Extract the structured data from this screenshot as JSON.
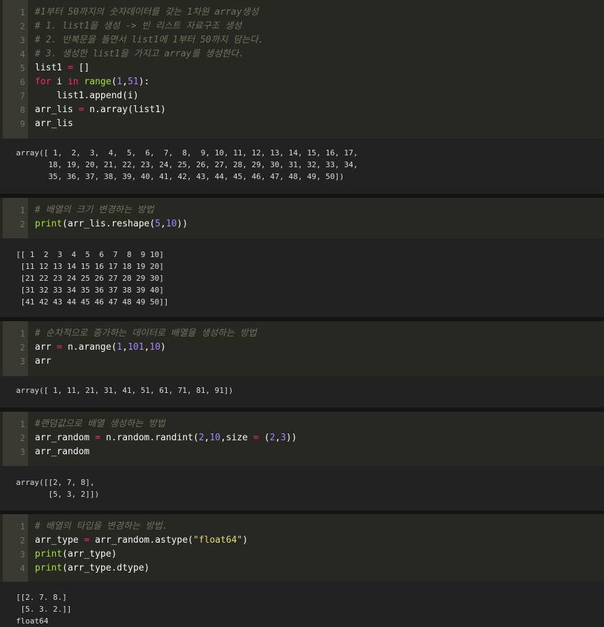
{
  "cells": [
    {
      "lines": [
        {
          "n": "1",
          "tokens": [
            {
              "t": "cm",
              "v": "#1부터 50까지의 숫자데이터를 갖는 1차원 array생성"
            }
          ]
        },
        {
          "n": "2",
          "tokens": [
            {
              "t": "cm",
              "v": "# 1. list1을 생성 -> 빈 리스트 자료구조 생성"
            }
          ]
        },
        {
          "n": "3",
          "tokens": [
            {
              "t": "cm",
              "v": "# 2. 반복문을 돌면서 list1에 1부터 50까지 담는다."
            }
          ]
        },
        {
          "n": "4",
          "tokens": [
            {
              "t": "cm",
              "v": "# 3. 생성한 list1을 가지고 array를 생성한다."
            }
          ]
        },
        {
          "n": "5",
          "tokens": [
            {
              "t": "plain",
              "v": "list1 "
            },
            {
              "t": "op",
              "v": "="
            },
            {
              "t": "plain",
              "v": " []"
            }
          ]
        },
        {
          "n": "6",
          "tokens": [
            {
              "t": "kw",
              "v": "for"
            },
            {
              "t": "plain",
              "v": " i "
            },
            {
              "t": "kw",
              "v": "in"
            },
            {
              "t": "plain",
              "v": " "
            },
            {
              "t": "fn",
              "v": "range"
            },
            {
              "t": "plain",
              "v": "("
            },
            {
              "t": "num",
              "v": "1"
            },
            {
              "t": "plain",
              "v": ","
            },
            {
              "t": "num",
              "v": "51"
            },
            {
              "t": "plain",
              "v": "):"
            }
          ]
        },
        {
          "n": "7",
          "tokens": [
            {
              "t": "plain",
              "v": "    list1.append(i)"
            }
          ]
        },
        {
          "n": "8",
          "tokens": [
            {
              "t": "plain",
              "v": "arr_lis "
            },
            {
              "t": "op",
              "v": "="
            },
            {
              "t": "plain",
              "v": " n.array(list1)"
            }
          ]
        },
        {
          "n": "9",
          "tokens": [
            {
              "t": "plain",
              "v": "arr_lis"
            }
          ]
        }
      ],
      "output": [
        "array([ 1,  2,  3,  4,  5,  6,  7,  8,  9, 10, 11, 12, 13, 14, 15, 16, 17,",
        "       18, 19, 20, 21, 22, 23, 24, 25, 26, 27, 28, 29, 30, 31, 32, 33, 34,",
        "       35, 36, 37, 38, 39, 40, 41, 42, 43, 44, 45, 46, 47, 48, 49, 50])"
      ]
    },
    {
      "lines": [
        {
          "n": "1",
          "tokens": [
            {
              "t": "cm",
              "v": "# 배열의 크기 변경하는 방법"
            }
          ]
        },
        {
          "n": "2",
          "tokens": [
            {
              "t": "fn",
              "v": "print"
            },
            {
              "t": "plain",
              "v": "(arr_lis.reshape("
            },
            {
              "t": "num",
              "v": "5"
            },
            {
              "t": "plain",
              "v": ","
            },
            {
              "t": "num",
              "v": "10"
            },
            {
              "t": "plain",
              "v": "))"
            }
          ]
        }
      ],
      "output": [
        "[[ 1  2  3  4  5  6  7  8  9 10]",
        " [11 12 13 14 15 16 17 18 19 20]",
        " [21 22 23 24 25 26 27 28 29 30]",
        " [31 32 33 34 35 36 37 38 39 40]",
        " [41 42 43 44 45 46 47 48 49 50]]"
      ]
    },
    {
      "lines": [
        {
          "n": "1",
          "tokens": [
            {
              "t": "cm",
              "v": "# 순차적으로 증가하는 데이터로 배열을 생성하는 방법"
            }
          ]
        },
        {
          "n": "2",
          "tokens": [
            {
              "t": "plain",
              "v": "arr "
            },
            {
              "t": "op",
              "v": "="
            },
            {
              "t": "plain",
              "v": " n.arange("
            },
            {
              "t": "num",
              "v": "1"
            },
            {
              "t": "plain",
              "v": ","
            },
            {
              "t": "num",
              "v": "101"
            },
            {
              "t": "plain",
              "v": ","
            },
            {
              "t": "num",
              "v": "10"
            },
            {
              "t": "plain",
              "v": ")"
            }
          ]
        },
        {
          "n": "3",
          "tokens": [
            {
              "t": "plain",
              "v": "arr"
            }
          ]
        }
      ],
      "output": [
        "array([ 1, 11, 21, 31, 41, 51, 61, 71, 81, 91])"
      ]
    },
    {
      "lines": [
        {
          "n": "1",
          "tokens": [
            {
              "t": "cm",
              "v": "#랜덤값으로 배열 생성하는 방법"
            }
          ]
        },
        {
          "n": "2",
          "tokens": [
            {
              "t": "plain",
              "v": "arr_random "
            },
            {
              "t": "op",
              "v": "="
            },
            {
              "t": "plain",
              "v": " n.random.randint("
            },
            {
              "t": "num",
              "v": "2"
            },
            {
              "t": "plain",
              "v": ","
            },
            {
              "t": "num",
              "v": "10"
            },
            {
              "t": "plain",
              "v": ",size "
            },
            {
              "t": "op",
              "v": "="
            },
            {
              "t": "plain",
              "v": " ("
            },
            {
              "t": "num",
              "v": "2"
            },
            {
              "t": "plain",
              "v": ","
            },
            {
              "t": "num",
              "v": "3"
            },
            {
              "t": "plain",
              "v": "))"
            }
          ]
        },
        {
          "n": "3",
          "tokens": [
            {
              "t": "plain",
              "v": "arr_random"
            }
          ]
        }
      ],
      "output": [
        "array([[2, 7, 8],",
        "       [5, 3, 2]])"
      ]
    },
    {
      "lines": [
        {
          "n": "1",
          "tokens": [
            {
              "t": "cm",
              "v": "# 배열의 타입을 변경하는 방법."
            }
          ]
        },
        {
          "n": "2",
          "tokens": [
            {
              "t": "plain",
              "v": "arr_type "
            },
            {
              "t": "op",
              "v": "="
            },
            {
              "t": "plain",
              "v": " arr_random.astype("
            },
            {
              "t": "str",
              "v": "\"float64\""
            },
            {
              "t": "plain",
              "v": ")"
            }
          ]
        },
        {
          "n": "3",
          "tokens": [
            {
              "t": "fn",
              "v": "print"
            },
            {
              "t": "plain",
              "v": "(arr_type)"
            }
          ]
        },
        {
          "n": "4",
          "tokens": [
            {
              "t": "fn",
              "v": "print"
            },
            {
              "t": "plain",
              "v": "(arr_type.dtype)"
            }
          ]
        }
      ],
      "output": [
        "[[2. 7. 8.]",
        " [5. 3. 2.]]",
        "float64"
      ]
    }
  ]
}
